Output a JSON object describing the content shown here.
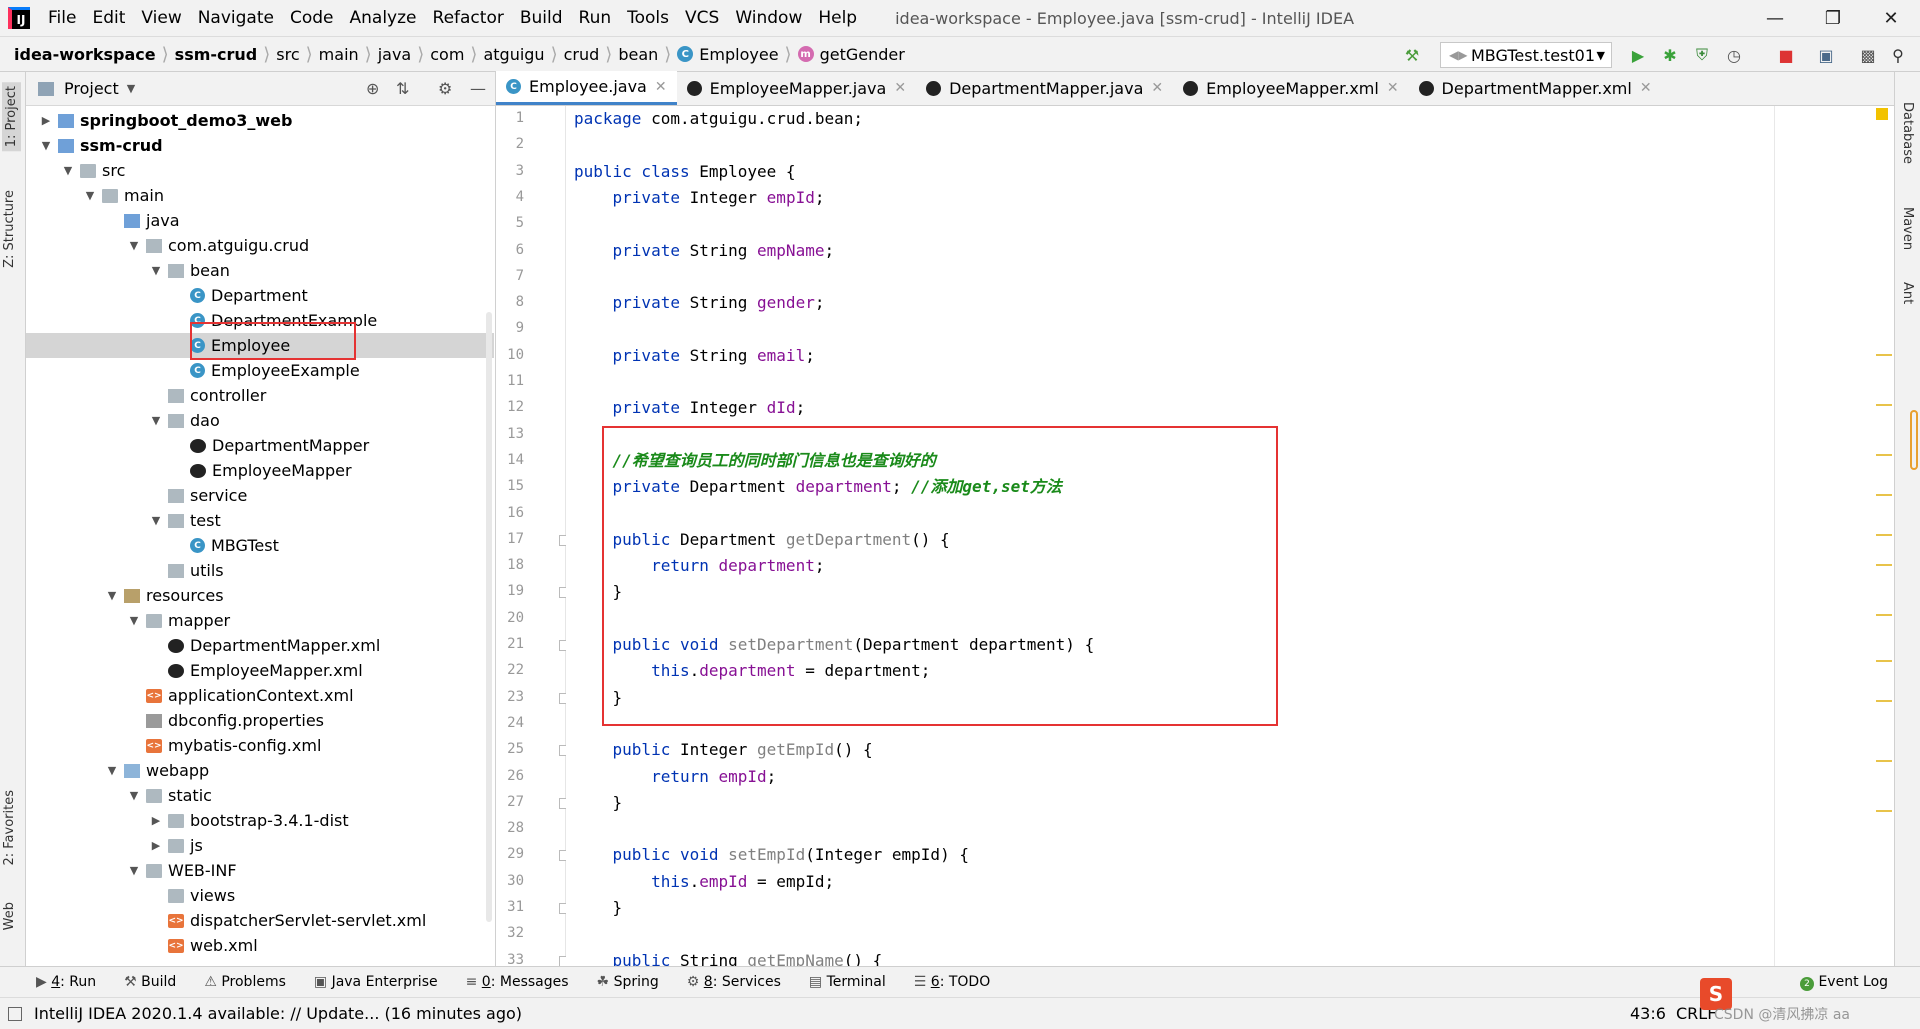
{
  "menubar": {
    "items": [
      "File",
      "Edit",
      "View",
      "Navigate",
      "Code",
      "Analyze",
      "Refactor",
      "Build",
      "Run",
      "Tools",
      "VCS",
      "Window",
      "Help"
    ],
    "title": "idea-workspace - Employee.java [ssm-crud] - IntelliJ IDEA"
  },
  "navbar": {
    "breadcrumbs": [
      "idea-workspace",
      "ssm-crud",
      "src",
      "main",
      "java",
      "com",
      "atguigu",
      "crud",
      "bean",
      "Employee",
      "getGender"
    ],
    "run_config": "MBGTest.test01"
  },
  "side_tabs": {
    "project": "1: Project",
    "structure": "Z: Structure",
    "favorites": "2: Favorites",
    "web": "Web",
    "database": "Database",
    "maven": "Maven",
    "ant": "Ant"
  },
  "project_panel": {
    "title": "Project",
    "tree": [
      {
        "label": "springboot_demo3_web",
        "bold": true
      },
      {
        "label": "ssm-crud",
        "bold": true
      },
      {
        "label": "src"
      },
      {
        "label": "main"
      },
      {
        "label": "java"
      },
      {
        "label": "com.atguigu.crud"
      },
      {
        "label": "bean"
      },
      {
        "label": "Department"
      },
      {
        "label": "DepartmentExample"
      },
      {
        "label": "Employee"
      },
      {
        "label": "EmployeeExample"
      },
      {
        "label": "controller"
      },
      {
        "label": "dao"
      },
      {
        "label": "DepartmentMapper"
      },
      {
        "label": "EmployeeMapper"
      },
      {
        "label": "service"
      },
      {
        "label": "test"
      },
      {
        "label": "MBGTest"
      },
      {
        "label": "utils"
      },
      {
        "label": "resources"
      },
      {
        "label": "mapper"
      },
      {
        "label": "DepartmentMapper.xml"
      },
      {
        "label": "EmployeeMapper.xml"
      },
      {
        "label": "applicationContext.xml"
      },
      {
        "label": "dbconfig.properties"
      },
      {
        "label": "mybatis-config.xml"
      },
      {
        "label": "webapp"
      },
      {
        "label": "static"
      },
      {
        "label": "bootstrap-3.4.1-dist"
      },
      {
        "label": "js"
      },
      {
        "label": "WEB-INF"
      },
      {
        "label": "views"
      },
      {
        "label": "dispatcherServlet-servlet.xml"
      },
      {
        "label": "web.xml"
      }
    ]
  },
  "editor": {
    "tabs": [
      "Employee.java",
      "EmployeeMapper.java",
      "DepartmentMapper.java",
      "EmployeeMapper.xml",
      "DepartmentMapper.xml"
    ],
    "line_numbers": [
      "1",
      "2",
      "3",
      "4",
      "5",
      "6",
      "7",
      "8",
      "9",
      "10",
      "11",
      "12",
      "13",
      "14",
      "15",
      "16",
      "17",
      "18",
      "19",
      "20",
      "21",
      "22",
      "23",
      "24",
      "25",
      "26",
      "27",
      "28",
      "29",
      "30",
      "31",
      "32",
      "33"
    ],
    "code": [
      [
        {
          "t": "package",
          "c": "kw"
        },
        {
          "t": " com.atguigu.crud.bean;"
        }
      ],
      [],
      [
        {
          "t": "public class",
          "c": "kw"
        },
        {
          "t": " Employee {"
        }
      ],
      [
        {
          "t": "    "
        },
        {
          "t": "private",
          "c": "kw"
        },
        {
          "t": " Integer "
        },
        {
          "t": "empId",
          "c": "fld"
        },
        {
          "t": ";"
        }
      ],
      [],
      [
        {
          "t": "    "
        },
        {
          "t": "private",
          "c": "kw"
        },
        {
          "t": " String "
        },
        {
          "t": "empName",
          "c": "fld"
        },
        {
          "t": ";"
        }
      ],
      [],
      [
        {
          "t": "    "
        },
        {
          "t": "private",
          "c": "kw"
        },
        {
          "t": " String "
        },
        {
          "t": "gender",
          "c": "fld"
        },
        {
          "t": ";"
        }
      ],
      [],
      [
        {
          "t": "    "
        },
        {
          "t": "private",
          "c": "kw"
        },
        {
          "t": " String "
        },
        {
          "t": "email",
          "c": "fld"
        },
        {
          "t": ";"
        }
      ],
      [],
      [
        {
          "t": "    "
        },
        {
          "t": "private",
          "c": "kw"
        },
        {
          "t": " Integer "
        },
        {
          "t": "dId",
          "c": "fld"
        },
        {
          "t": ";"
        }
      ],
      [],
      [
        {
          "t": "    "
        },
        {
          "t": "//希望查询员工的同时部门信息也是查询好的",
          "c": "cmt"
        }
      ],
      [
        {
          "t": "    "
        },
        {
          "t": "private",
          "c": "kw"
        },
        {
          "t": " Department "
        },
        {
          "t": "department",
          "c": "fld"
        },
        {
          "t": "; "
        },
        {
          "t": "//添加get,set方法",
          "c": "cmt"
        }
      ],
      [],
      [
        {
          "t": "    "
        },
        {
          "t": "public",
          "c": "kw"
        },
        {
          "t": " Department "
        },
        {
          "t": "getDepartment",
          "c": "mth"
        },
        {
          "t": "() {"
        }
      ],
      [
        {
          "t": "        "
        },
        {
          "t": "return",
          "c": "kw"
        },
        {
          "t": " "
        },
        {
          "t": "department",
          "c": "fld"
        },
        {
          "t": ";"
        }
      ],
      [
        {
          "t": "    }"
        }
      ],
      [],
      [
        {
          "t": "    "
        },
        {
          "t": "public void",
          "c": "kw"
        },
        {
          "t": " "
        },
        {
          "t": "setDepartment",
          "c": "mth"
        },
        {
          "t": "(Department department) {"
        }
      ],
      [
        {
          "t": "        "
        },
        {
          "t": "this",
          "c": "kw"
        },
        {
          "t": "."
        },
        {
          "t": "department",
          "c": "fld"
        },
        {
          "t": " = department;"
        }
      ],
      [
        {
          "t": "    }"
        }
      ],
      [],
      [
        {
          "t": "    "
        },
        {
          "t": "public",
          "c": "kw"
        },
        {
          "t": " Integer "
        },
        {
          "t": "getEmpId",
          "c": "mth"
        },
        {
          "t": "() {"
        }
      ],
      [
        {
          "t": "        "
        },
        {
          "t": "return",
          "c": "kw"
        },
        {
          "t": " "
        },
        {
          "t": "empId",
          "c": "fld"
        },
        {
          "t": ";"
        }
      ],
      [
        {
          "t": "    }"
        }
      ],
      [],
      [
        {
          "t": "    "
        },
        {
          "t": "public void",
          "c": "kw"
        },
        {
          "t": " "
        },
        {
          "t": "setEmpId",
          "c": "mth"
        },
        {
          "t": "(Integer empId) {"
        }
      ],
      [
        {
          "t": "        "
        },
        {
          "t": "this",
          "c": "kw"
        },
        {
          "t": "."
        },
        {
          "t": "empId",
          "c": "fld"
        },
        {
          "t": " = empId;"
        }
      ],
      [
        {
          "t": "    }"
        }
      ],
      [],
      [
        {
          "t": "    "
        },
        {
          "t": "public",
          "c": "kw"
        },
        {
          "t": " String "
        },
        {
          "t": "getEmpName",
          "c": "mth"
        },
        {
          "t": "() {"
        }
      ]
    ]
  },
  "bottom_tools": [
    {
      "key": "4",
      "label": ": Run"
    },
    {
      "key": "",
      "label": "Build"
    },
    {
      "key": "",
      "label": "Problems"
    },
    {
      "key": "",
      "label": "Java Enterprise"
    },
    {
      "key": "0",
      "label": ": Messages"
    },
    {
      "key": "",
      "label": "Spring"
    },
    {
      "key": "8",
      "label": ": Services"
    },
    {
      "key": "",
      "label": "Terminal"
    },
    {
      "key": "6",
      "label": ": TODO"
    }
  ],
  "status": {
    "message": "IntelliJ IDEA 2020.1.4 available: // Update... (16 minutes ago)",
    "position": "43:6",
    "line_sep": "CRLF",
    "event_log": "Event Log",
    "event_count": "2",
    "watermark": "CSDN @清风拂凉 aa"
  },
  "colors": {
    "highlight_box": "#e53333",
    "accent": "#4083c9",
    "keyword": "#0033b3",
    "field": "#871094",
    "comment": "#1a8a1a"
  }
}
